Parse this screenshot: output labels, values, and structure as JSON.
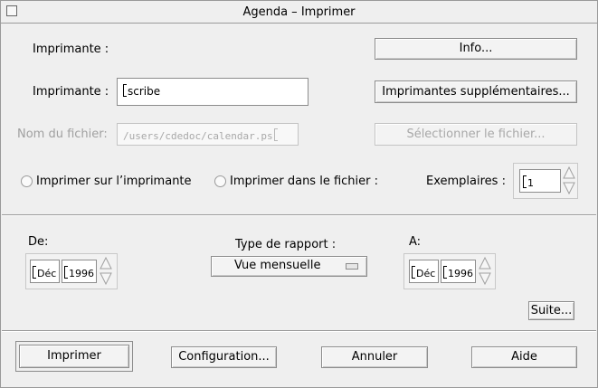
{
  "window": {
    "title": "Agenda – Imprimer"
  },
  "printer_section": {
    "printer_label_1": "Imprimante :",
    "info_button": "Info...",
    "printer_label_2": "Imprimante :",
    "printer_value": "scribe",
    "more_printers_button": "Imprimantes supplémentaires...",
    "file_name_label": "Nom du fichier:",
    "file_name_value": "/users/cdedoc/calendar.ps",
    "select_file_button": "Sélectionner le fichier...",
    "radio_printer": "Imprimer sur l’imprimante",
    "radio_file": "Imprimer dans le fichier :",
    "copies_label": "Exemplaires :",
    "copies_value": "1"
  },
  "report_section": {
    "from_label": "De:",
    "from_month": "Déc",
    "from_year": "1996",
    "report_type_label": "Type de rapport :",
    "report_type_value": "Vue mensuelle",
    "to_label": "A:",
    "to_month": "Déc",
    "to_year": "1996",
    "more_button": "Suite..."
  },
  "actions": {
    "print": "Imprimer",
    "setup": "Configuration...",
    "cancel": "Annuler",
    "help": "Aide"
  }
}
